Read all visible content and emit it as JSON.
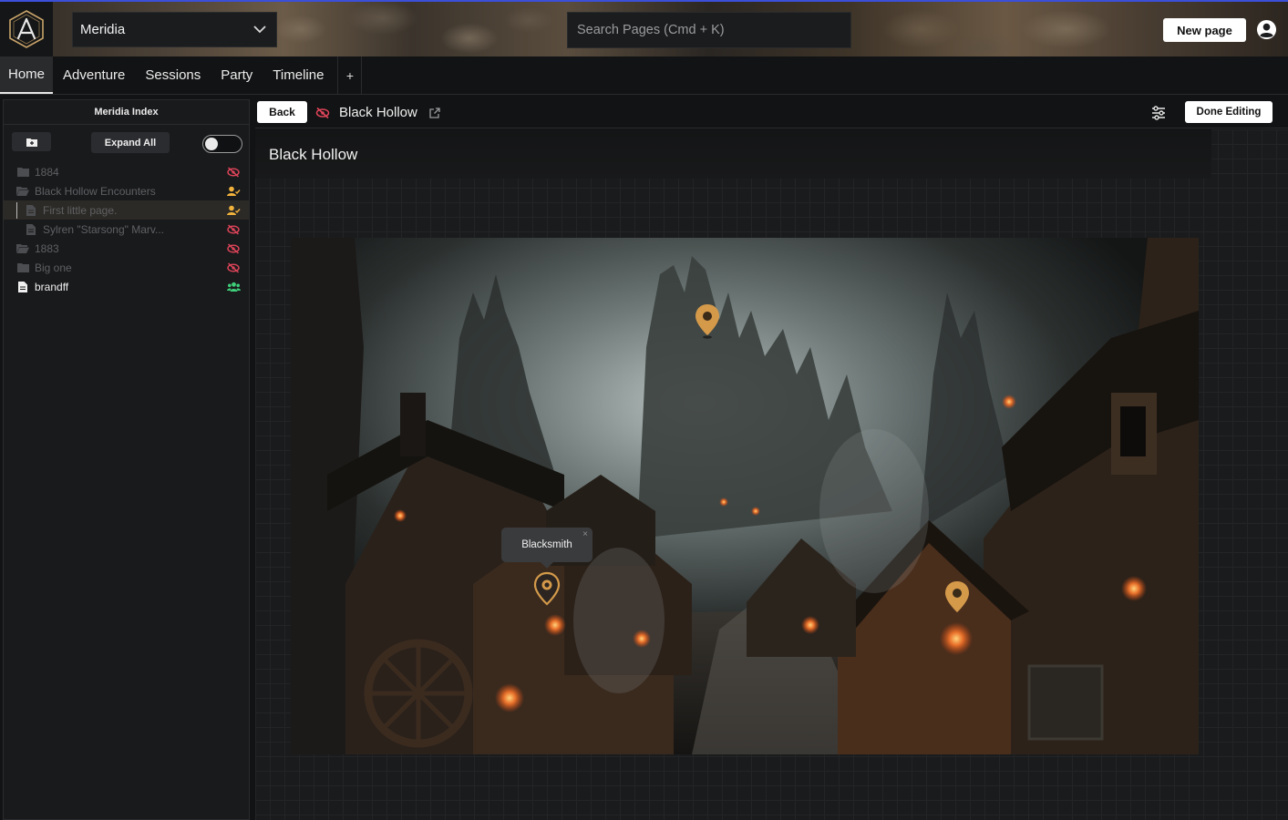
{
  "app": {
    "world_name": "Meridia",
    "search_placeholder": "Search Pages (Cmd + K)",
    "new_page_label": "New page"
  },
  "tabs": [
    {
      "label": "Home",
      "active": true
    },
    {
      "label": "Adventure",
      "active": false
    },
    {
      "label": "Sessions",
      "active": false
    },
    {
      "label": "Party",
      "active": false
    },
    {
      "label": "Timeline",
      "active": false
    }
  ],
  "tab_add_label": "+",
  "sidebar": {
    "title": "Meridia Index",
    "expand_all_label": "Expand All",
    "toggle_on": false,
    "items": [
      {
        "label": "1884",
        "type": "folder",
        "visibility": "hidden"
      },
      {
        "label": "Black Hollow Encounters",
        "type": "folder-open",
        "visibility": "shared-user"
      },
      {
        "label": "First little page.",
        "type": "page",
        "visibility": "shared-user",
        "selected": true
      },
      {
        "label": "Sylren \"Starsong\" Marv...",
        "type": "page",
        "visibility": "hidden"
      },
      {
        "label": "1883",
        "type": "folder-open",
        "visibility": "hidden"
      },
      {
        "label": "Big one",
        "type": "folder",
        "visibility": "hidden"
      },
      {
        "label": "brandff",
        "type": "page",
        "visibility": "party"
      }
    ]
  },
  "page": {
    "back_label": "Back",
    "breadcrumb_title": "Black Hollow",
    "done_editing_label": "Done Editing",
    "title": "Black Hollow"
  },
  "map": {
    "pins": [
      {
        "id": "pin-top",
        "label": ""
      },
      {
        "id": "pin-blacksmith",
        "label": "Blacksmith"
      },
      {
        "id": "pin-right",
        "label": ""
      }
    ],
    "tooltip_text": "Blacksmith",
    "tooltip_close": "×"
  },
  "colors": {
    "accent_red": "#e0455a",
    "accent_yellow": "#f2b33d",
    "accent_green": "#3fcf7a",
    "pin": "#d49a4a"
  }
}
